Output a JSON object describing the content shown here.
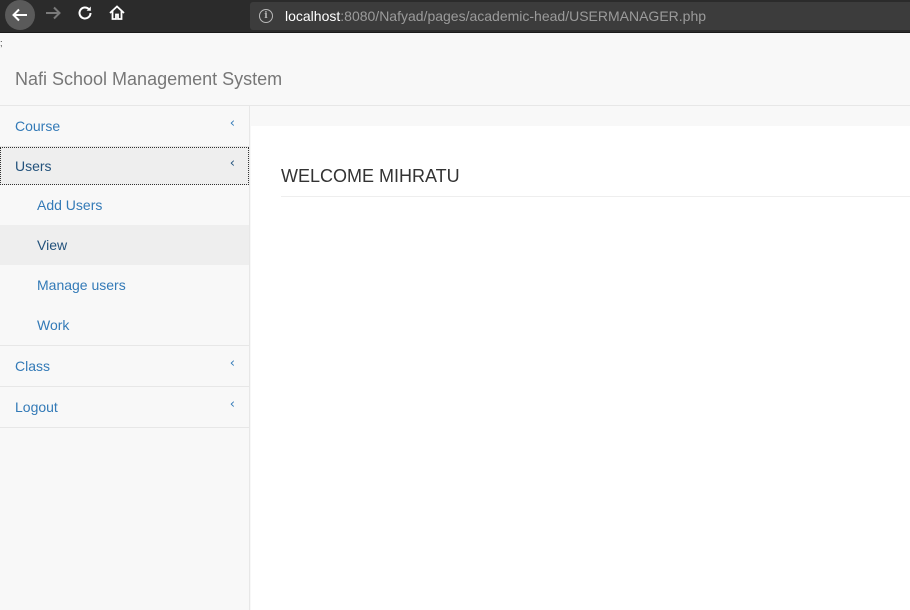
{
  "browser": {
    "url_host": "localhost",
    "url_rest": ":8080/Nafyad/pages/academic-head/USERMANAGER.php",
    "icons": [
      "back-arrow-icon",
      "forward-arrow-icon",
      "reload-icon",
      "home-icon",
      "info-icon"
    ]
  },
  "page": {
    "stray_text": ";",
    "brand": "Nafi School Management System",
    "welcome": "WELCOME MIHRATU"
  },
  "sidebar": {
    "items": [
      {
        "label": "Course"
      },
      {
        "label": "Users"
      },
      {
        "label": "Class"
      },
      {
        "label": "Logout"
      }
    ],
    "users_submenu": [
      {
        "label": "Add Users"
      },
      {
        "label": "View"
      },
      {
        "label": "Manage users"
      },
      {
        "label": "Work"
      }
    ]
  },
  "colors": {
    "link": "#337ab7",
    "link_active": "#23527c",
    "brand": "#777777",
    "chrome": "#2b2b2b"
  }
}
